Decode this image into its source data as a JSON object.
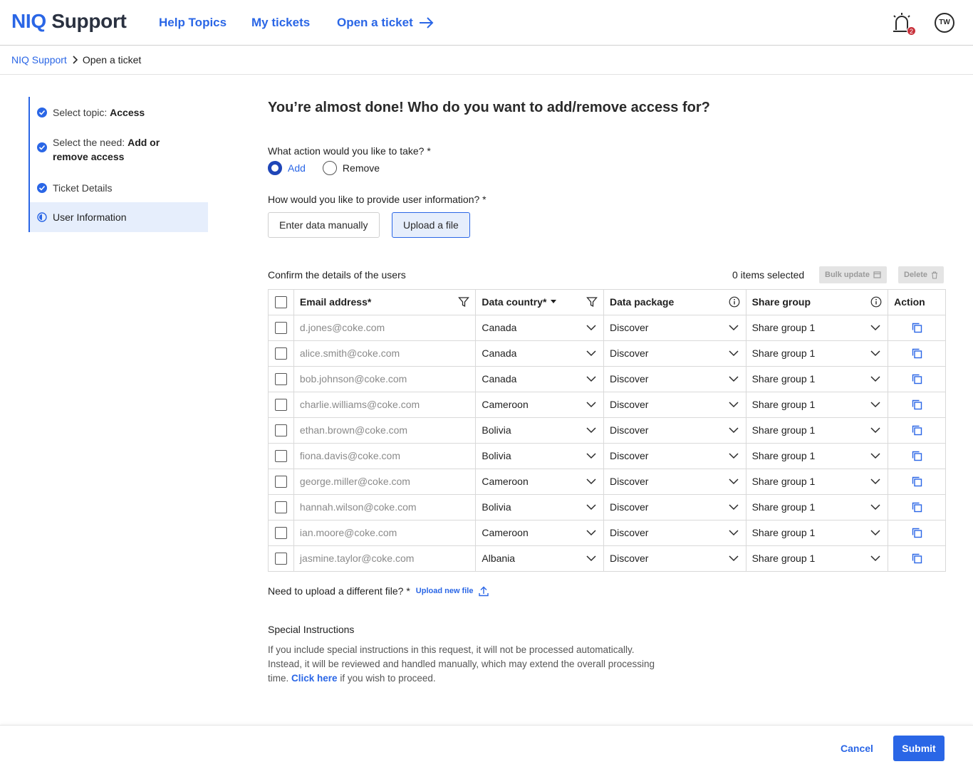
{
  "header": {
    "brand_prefix": "NIQ",
    "brand_suffix": "Support",
    "nav": {
      "help": "Help Topics",
      "tickets": "My tickets",
      "open": "Open a ticket"
    },
    "notification_count": "2",
    "avatar_initials": "TW"
  },
  "breadcrumb": {
    "home": "NIQ Support",
    "current": "Open a ticket"
  },
  "stepper": {
    "step1_prefix": "Select topic: ",
    "step1_value": "Access",
    "step2_prefix": "Select the need: ",
    "step2_value": "Add or remove access",
    "step3": "Ticket Details",
    "step4": "User Information"
  },
  "main": {
    "title": "You’re almost done! Who do you want to add/remove access for?",
    "action_question": "What action would you like to take? *",
    "radio_add": "Add",
    "radio_remove": "Remove",
    "provide_question": "How would you like to provide user information? *",
    "btn_manual": "Enter data manually",
    "btn_upload": "Upload a file",
    "confirm_label": "Confirm the details of the users",
    "items_selected": "0 items selected",
    "btn_bulk": "Bulk update",
    "btn_delete": "Delete"
  },
  "table": {
    "headers": {
      "email": "Email address*",
      "country": "Data country*",
      "package": "Data package",
      "share": "Share group",
      "action": "Action"
    },
    "rows": [
      {
        "email": "d.jones@coke.com",
        "country": "Canada",
        "package": "Discover",
        "share": "Share group 1"
      },
      {
        "email": "alice.smith@coke.com",
        "country": "Canada",
        "package": "Discover",
        "share": "Share group 1"
      },
      {
        "email": "bob.johnson@coke.com",
        "country": "Canada",
        "package": "Discover",
        "share": "Share group 1"
      },
      {
        "email": "charlie.williams@coke.com",
        "country": "Cameroon",
        "package": "Discover",
        "share": "Share group 1"
      },
      {
        "email": "ethan.brown@coke.com",
        "country": "Bolivia",
        "package": "Discover",
        "share": "Share group 1"
      },
      {
        "email": "fiona.davis@coke.com",
        "country": "Bolivia",
        "package": "Discover",
        "share": "Share group 1"
      },
      {
        "email": "george.miller@coke.com",
        "country": "Cameroon",
        "package": "Discover",
        "share": "Share group 1"
      },
      {
        "email": "hannah.wilson@coke.com",
        "country": "Bolivia",
        "package": "Discover",
        "share": "Share group 1"
      },
      {
        "email": "ian.moore@coke.com",
        "country": "Cameroon",
        "package": "Discover",
        "share": "Share group 1"
      },
      {
        "email": "jasmine.taylor@coke.com",
        "country": "Albania",
        "package": "Discover",
        "share": "Share group 1"
      }
    ]
  },
  "upload": {
    "question": "Need to upload a different file? *",
    "link": "Upload new file"
  },
  "special": {
    "title": "Special Instructions",
    "text_before": "If you include special instructions in this request, it will not be processed automatically. Instead, it will be reviewed and handled manually, which may extend the overall processing time. ",
    "link": "Click here",
    "text_after": " if you wish to proceed."
  },
  "footer": {
    "cancel": "Cancel",
    "submit": "Submit"
  },
  "colors": {
    "accent": "#2a66e6",
    "accent_dark": "#1f46b8",
    "selected_bg": "#e6eefc",
    "badge": "#c8303a"
  }
}
